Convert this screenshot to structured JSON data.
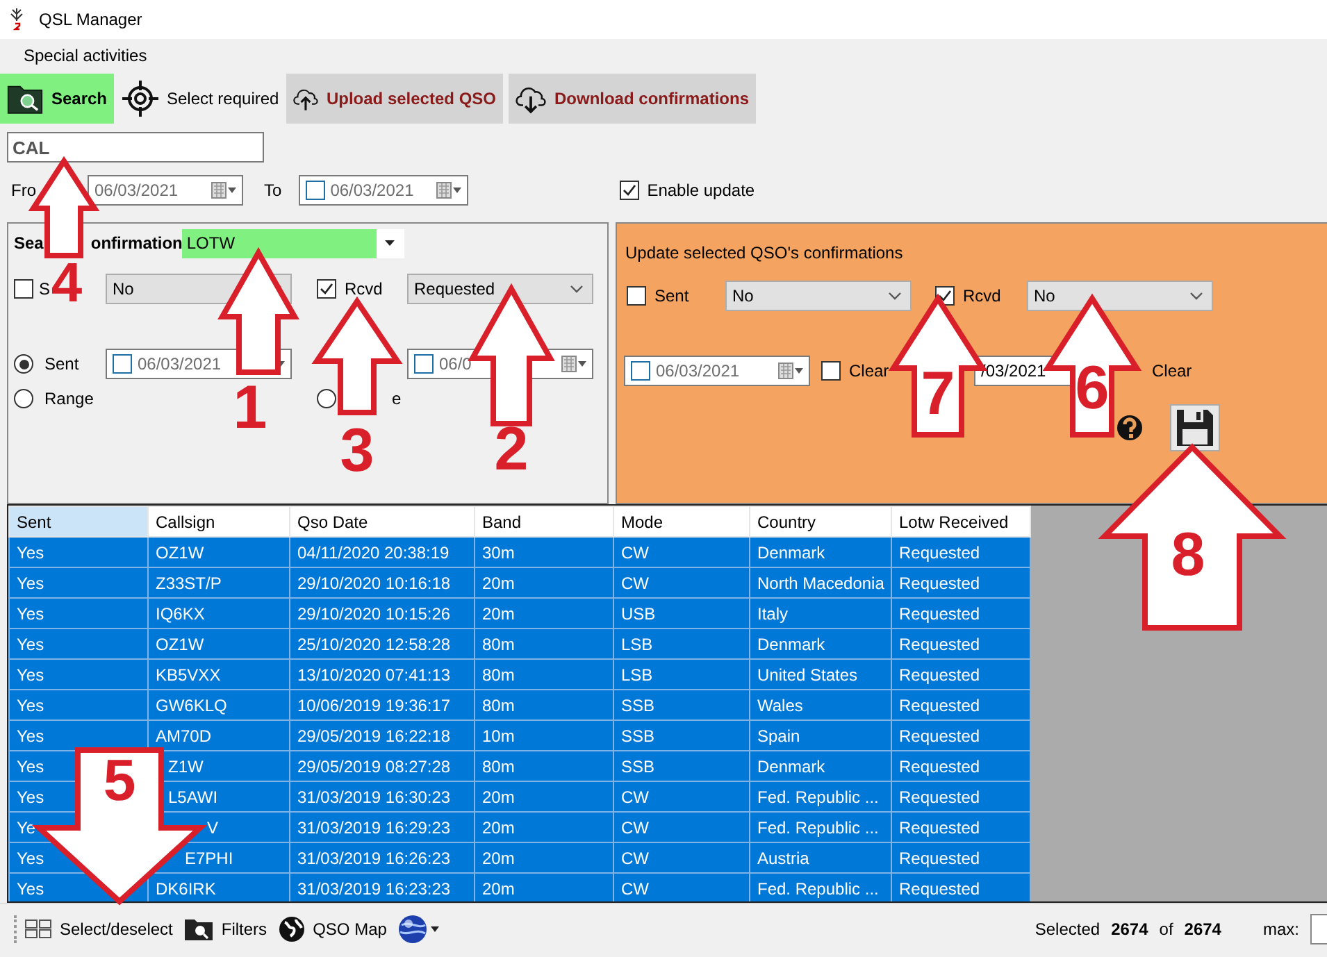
{
  "window": {
    "title": "QSL Manager"
  },
  "menu": [
    {
      "label": "Special activities"
    }
  ],
  "toolbar": [
    {
      "label": "Search",
      "kind": "search",
      "active": true
    },
    {
      "label": "Select required",
      "kind": "target",
      "active": false
    },
    {
      "label": "Upload selected QSO",
      "kind": "upload",
      "active": false
    },
    {
      "label": "Download confirmations",
      "kind": "download",
      "active": false
    }
  ],
  "callsign_field": {
    "value": "CAL"
  },
  "date_range": {
    "from_label": "Fro",
    "from_date": "06/03/2021",
    "to_label": "To",
    "to_checked": false,
    "to_date": "06/03/2021"
  },
  "enable_update": {
    "label": "Enable update",
    "checked": true
  },
  "search_confirmation": {
    "title_parts": [
      "Sea",
      "onfirmation"
    ],
    "service": "LOTW",
    "sent": {
      "label": "S",
      "checked": false,
      "value": "No"
    },
    "rcvd": {
      "label": "Rcvd",
      "checked": true,
      "value": "Requested"
    },
    "date_mode": [
      {
        "label": "Sent",
        "selected": true
      },
      {
        "label": "Range",
        "selected": false
      }
    ],
    "sent_date": {
      "checked": false,
      "value": "06/03/2021"
    },
    "rcvd_date_mode": [
      {
        "label": "e",
        "selected": false
      }
    ],
    "rcvd_date": {
      "checked": false,
      "value": "06/0"
    }
  },
  "update_confirmations": {
    "title": "Update selected QSO's confirmations",
    "sent": {
      "label": "Sent",
      "checked": false,
      "value": "No"
    },
    "rcvd": {
      "label": "Rcvd",
      "checked": true,
      "value": "No"
    },
    "sent_date": {
      "checked": false,
      "value": "06/03/2021"
    },
    "sent_clear": {
      "label": "Clear",
      "checked": false
    },
    "rcvd_date": {
      "value": "/03/2021"
    },
    "rcvd_clear": {
      "label": "Clear"
    }
  },
  "table": {
    "columns": [
      {
        "label": "Sent",
        "selected": true
      },
      {
        "label": "Callsign",
        "selected": false
      },
      {
        "label": "Qso Date",
        "selected": false
      },
      {
        "label": "Band",
        "selected": false
      },
      {
        "label": "Mode",
        "selected": false
      },
      {
        "label": "Country",
        "selected": false
      },
      {
        "label": "Lotw Received",
        "selected": false
      }
    ],
    "rows": [
      [
        "Yes",
        "OZ1W",
        "04/11/2020 20:38:19",
        "30m",
        "CW",
        "Denmark",
        "Requested"
      ],
      [
        "Yes",
        "Z33ST/P",
        "29/10/2020 10:16:18",
        "20m",
        "CW",
        "North Macedonia",
        "Requested"
      ],
      [
        "Yes",
        "IQ6KX",
        "29/10/2020 10:15:26",
        "20m",
        "USB",
        "Italy",
        "Requested"
      ],
      [
        "Yes",
        "OZ1W",
        "25/10/2020 12:58:28",
        "80m",
        "LSB",
        "Denmark",
        "Requested"
      ],
      [
        "Yes",
        "KB5VXX",
        "13/10/2020 07:41:13",
        "80m",
        "LSB",
        "United States",
        "Requested"
      ],
      [
        "Yes",
        "GW6KLQ",
        "10/06/2019 19:36:17",
        "80m",
        "SSB",
        "Wales",
        "Requested"
      ],
      [
        "Yes",
        "AM70D",
        "29/05/2019 16:22:18",
        "10m",
        "SSB",
        "Spain",
        "Requested"
      ],
      [
        "Yes",
        "Z1W",
        "29/05/2019 08:27:28",
        "80m",
        "SSB",
        "Denmark",
        "Requested"
      ],
      [
        "Yes",
        "L5AWI",
        "31/03/2019 16:30:23",
        "20m",
        "CW",
        "Fed. Republic ...",
        "Requested"
      ],
      [
        "Ye",
        "V",
        "31/03/2019 16:29:23",
        "20m",
        "CW",
        "Fed. Republic ...",
        "Requested"
      ],
      [
        "Yes",
        "E7PHI",
        "31/03/2019 16:26:23",
        "20m",
        "CW",
        "Austria",
        "Requested"
      ],
      [
        "Yes",
        "DK6IRK",
        "31/03/2019 16:23:23",
        "20m",
        "CW",
        "Fed. Republic ...",
        "Requested"
      ]
    ]
  },
  "status_bar": {
    "items": [
      {
        "label": "Select/deselect",
        "kind": "grid"
      },
      {
        "label": "Filters",
        "kind": "folder"
      },
      {
        "label": "QSO Map",
        "kind": "globe"
      }
    ],
    "selected_label": "Selected",
    "selected_count": "2674",
    "of_label": "of",
    "total": "2674",
    "max_label": "max:"
  },
  "annotations": [
    {
      "number": "1",
      "kind": "up"
    },
    {
      "number": "2",
      "kind": "up"
    },
    {
      "number": "3",
      "kind": "up"
    },
    {
      "number": "4",
      "kind": "up"
    },
    {
      "number": "5",
      "kind": "down"
    },
    {
      "number": "7",
      "kind": "up"
    },
    {
      "number": "6",
      "kind": "up"
    },
    {
      "number": "8",
      "kind": "up"
    }
  ]
}
